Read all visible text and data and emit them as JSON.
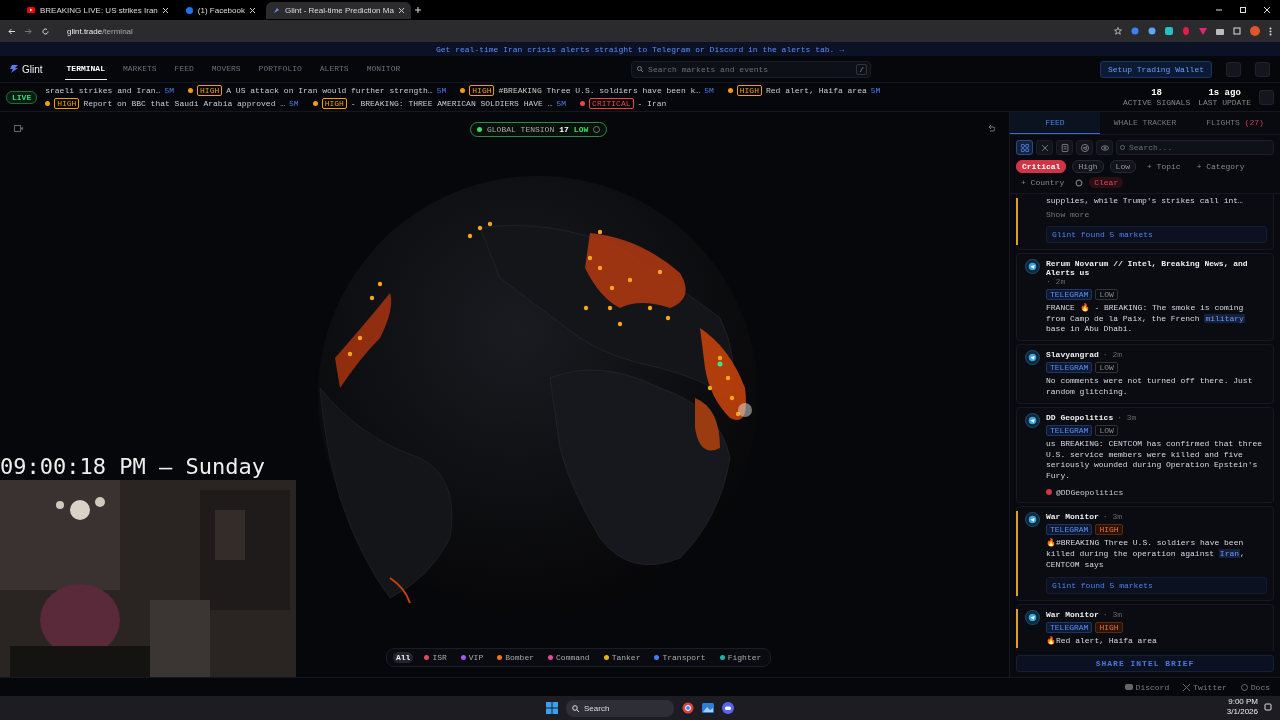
{
  "browser": {
    "tabs": [
      {
        "title": "BREAKING LIVE: US strikes Iran",
        "kind": "video",
        "selected": false
      },
      {
        "title": "(1) Facebook",
        "kind": "social",
        "selected": false
      },
      {
        "title": "Glint - Real-time Prediction Ma",
        "kind": "app",
        "selected": true
      }
    ],
    "url_host": "glint.trade",
    "url_path": "/terminal"
  },
  "banner": "Get real-time Iran crisis alerts straight to Telegram or Discord in the alerts tab. →",
  "nav": {
    "logo": "Glint",
    "tabs": [
      {
        "label": "TERMINAL",
        "selected": true
      },
      {
        "label": "MARKETS",
        "selected": false
      },
      {
        "label": "FEED",
        "selected": false
      },
      {
        "label": "MOVERS",
        "selected": false
      },
      {
        "label": "PORTFOLIO",
        "selected": false
      },
      {
        "label": "ALERTS",
        "selected": false
      },
      {
        "label": "MONITOR",
        "selected": false
      }
    ],
    "search_placeholder": "Search markets and events",
    "search_key": "/",
    "wallet_button": "Setup Trading Wallet"
  },
  "ticker": {
    "live": "LIVE",
    "items": [
      {
        "text": "sraeli strikes and Iran…",
        "age": "5M"
      },
      {
        "color": "#f59e0b",
        "badge": "HIGH",
        "text": "A US attack on Iran would further strength…",
        "age": "5M"
      },
      {
        "color": "#f59e0b",
        "badge": "HIGH",
        "text": "#BREAKING Three U.S. soldiers have been k…",
        "age": "5M"
      },
      {
        "color": "#f59e0b",
        "badge": "HIGH",
        "text": "Red alert, Haifa area",
        "age": "5M"
      },
      {
        "color": "#f59e0b",
        "badge": "HIGH",
        "text": "Report on BBC that Saudi Arabia approved …",
        "age": "5M"
      },
      {
        "color": "#f59e0b",
        "badge": "HIGH",
        "text": "- BREAKING: THREE AMERICAN SOLDIERS HAVE …",
        "age": "5M"
      },
      {
        "color": "#ef4444",
        "badge": "CRITICAL",
        "text": "- Iran"
      }
    ],
    "stats": [
      {
        "value": "18",
        "label": "ACTIVE SIGNALS"
      },
      {
        "value": "1s ago",
        "label": "LAST UPDATE"
      }
    ]
  },
  "map": {
    "tension": {
      "label": "GLOBAL TENSION",
      "value": "17",
      "level_text": "LOW"
    },
    "clock": "09:00:18 PM – Sunday",
    "legend": [
      {
        "label": "All",
        "selected": true
      },
      {
        "label": "ISR",
        "color": "#e0475b",
        "selected": false
      },
      {
        "label": "VIP",
        "color": "#a855f7",
        "selected": false
      },
      {
        "label": "Bomber",
        "color": "#f97316",
        "selected": false
      },
      {
        "label": "Command",
        "color": "#ec4899",
        "selected": false
      },
      {
        "label": "Tanker",
        "color": "#eab308",
        "selected": false
      },
      {
        "label": "Transport",
        "color": "#3b82f6",
        "selected": false
      },
      {
        "label": "Fighter",
        "color": "#14b8a6",
        "selected": false
      }
    ]
  },
  "panel": {
    "tabs": [
      {
        "label": "FEED",
        "selected": true
      },
      {
        "label": "WHALE TRACKER",
        "selected": false
      },
      {
        "label": "FLIGHTS",
        "count": "(27)",
        "selected": false
      }
    ],
    "sources": [
      {
        "kind": "grid",
        "selected": true
      },
      {
        "kind": "x",
        "selected": false
      },
      {
        "kind": "doc",
        "selected": false
      },
      {
        "kind": "telegram",
        "selected": false
      },
      {
        "kind": "eye",
        "selected": false
      }
    ],
    "search_placeholder": "Search...",
    "chips": [
      {
        "label": "Critical",
        "kind": "level",
        "selected": true
      },
      {
        "label": "High",
        "kind": "level",
        "selected": false
      },
      {
        "label": "Low",
        "kind": "level",
        "selected": false
      },
      {
        "label": "+ Topic",
        "kind": "add"
      },
      {
        "label": "+ Category",
        "kind": "add"
      },
      {
        "label": "+ Country",
        "kind": "add"
      },
      {
        "kind": "gear"
      },
      {
        "label": "Clear",
        "kind": "clear"
      }
    ],
    "feed": [
      {
        "highlighted": true,
        "text": "supplies, while Trump's strikes call int…",
        "show_more": "Show more",
        "markets": "Glint found 5 markets"
      },
      {
        "highlighted": false,
        "author": "Rerum Novarum // Intel, Breaking News, and Alerts us",
        "time": "· 2m",
        "source": "TELEGRAM",
        "badge": "LOW",
        "text": "FRANCE 🔥 - BREAKING: The smoke is coming from Camp de la Paix, the French **military** base in Abu Dhabi."
      },
      {
        "highlighted": false,
        "author": "Slavyangrad",
        "time": "· 2m",
        "source": "TELEGRAM",
        "badge": "LOW",
        "text": "No comments were not turned off there. Just random glitching."
      },
      {
        "highlighted": false,
        "author": "DD Geopolitics",
        "time": "· 3m",
        "source": "TELEGRAM",
        "badge": "LOW",
        "text": "us BREAKING: CENTCOM has confirmed that three U.S. service members were killed and five seriously wounded during Operation Epstein's Fury.",
        "handle": "@DDGeopolitics"
      },
      {
        "highlighted": true,
        "author": "War Monitor",
        "time": "· 3m",
        "source": "TELEGRAM",
        "badge": "HIGH",
        "text": "🔥#BREAKING Three U.S. soldiers have been killed during the operation against **Iran**, CENTCOM says",
        "markets": "Glint found 5 markets"
      },
      {
        "highlighted": true,
        "author": "War Monitor",
        "time": "· 3m",
        "source": "TELEGRAM",
        "badge": "HIGH",
        "text": "🔥Red alert, Haifa area"
      }
    ],
    "share": "SHARE INTEL BRIEF"
  },
  "footer": [
    {
      "label": "Discord",
      "kind": "discord"
    },
    {
      "label": "Twitter",
      "kind": "x"
    },
    {
      "label": "Docs",
      "kind": "docs"
    }
  ],
  "taskbar": {
    "search": "Search",
    "time": "9:00 PM",
    "date": "3/1/2026"
  }
}
